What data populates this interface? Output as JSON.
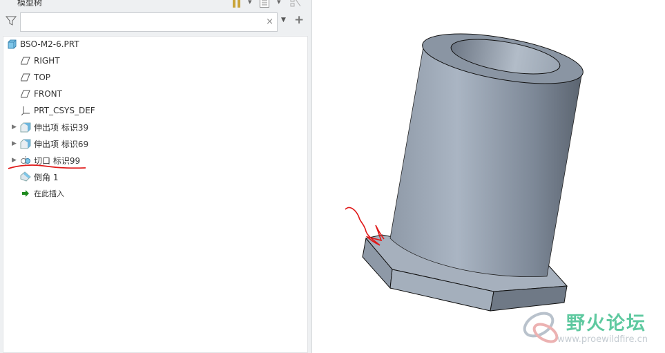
{
  "panel": {
    "title": "模型树",
    "search": {
      "value": "",
      "placeholder": ""
    },
    "clear": "×",
    "add": "+"
  },
  "tree": {
    "items": [
      {
        "label": "BSO-M2-6.PRT",
        "icon": "part-icon",
        "expandable": false
      },
      {
        "label": "RIGHT",
        "icon": "datum-plane-icon",
        "expandable": false
      },
      {
        "label": "TOP",
        "icon": "datum-plane-icon",
        "expandable": false
      },
      {
        "label": "FRONT",
        "icon": "datum-plane-icon",
        "expandable": false
      },
      {
        "label": "PRT_CSYS_DEF",
        "icon": "csys-icon",
        "expandable": false
      },
      {
        "label": "伸出项 标识39",
        "icon": "extrude-icon",
        "expandable": true
      },
      {
        "label": "伸出项 标识69",
        "icon": "extrude-icon",
        "expandable": true
      },
      {
        "label": "切口 标识99",
        "icon": "cut-icon",
        "expandable": true
      },
      {
        "label": "倒角 1",
        "icon": "chamfer-icon",
        "expandable": false
      },
      {
        "label": "在此插入",
        "icon": "insert-arrow-icon",
        "expandable": false
      }
    ]
  },
  "watermark": {
    "title": "野火论坛",
    "url": "www.proewildfire.cn"
  },
  "colors": {
    "annotation": "#e01818",
    "model": "#9aa6b4"
  }
}
